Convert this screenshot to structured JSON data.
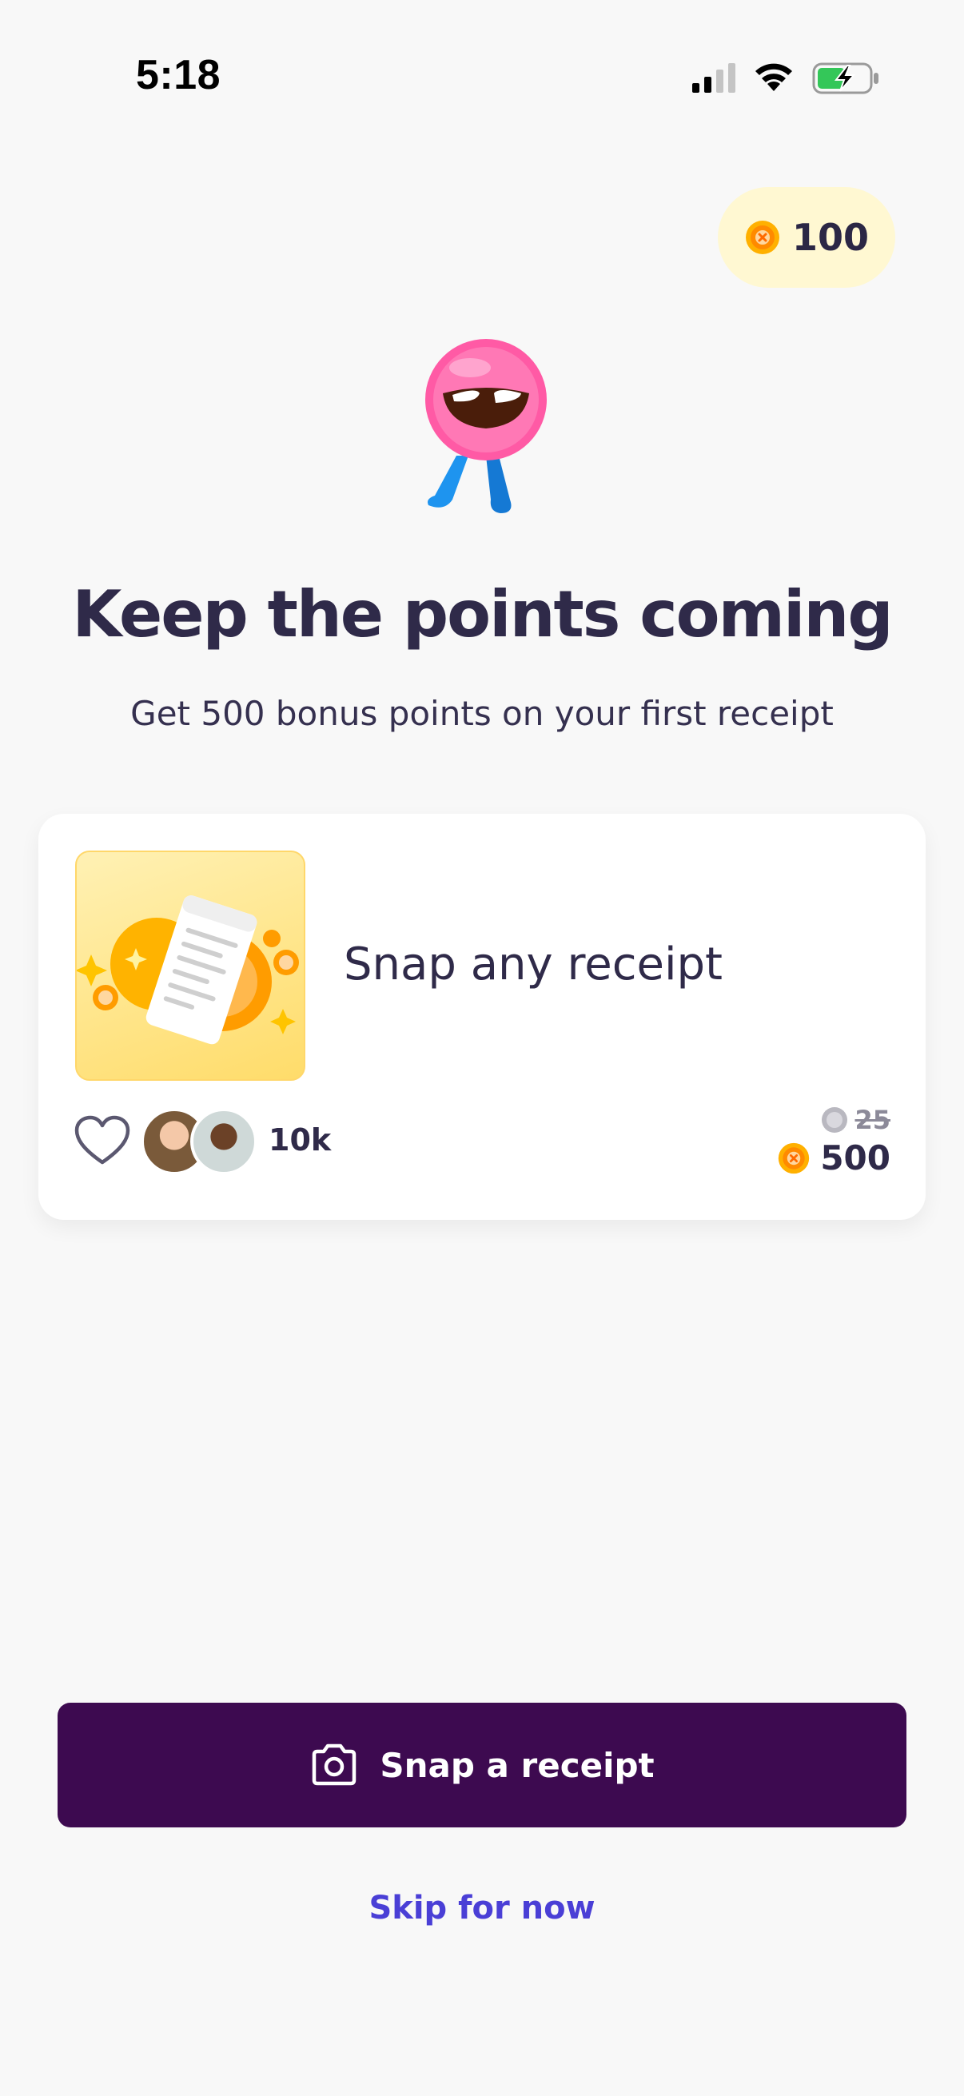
{
  "status_bar": {
    "time": "5:18"
  },
  "points_pill": {
    "value": "100",
    "icon": "coin-icon",
    "color": "#fff8d2"
  },
  "hero": {
    "mascot": "pink-mascot-icon",
    "title": "Keep the points coming",
    "subtitle": "Get 500 bonus points on your first receipt"
  },
  "offer_card": {
    "image": "receipt-coins-illustration",
    "title": "Snap any receipt",
    "likes": "10k",
    "old_points": "25",
    "new_points": "500"
  },
  "actions": {
    "primary_label": "Snap a receipt",
    "primary_icon": "camera-icon",
    "primary_color": "#3d0a50",
    "skip_label": "Skip for now",
    "skip_color": "#4a3fd6"
  }
}
